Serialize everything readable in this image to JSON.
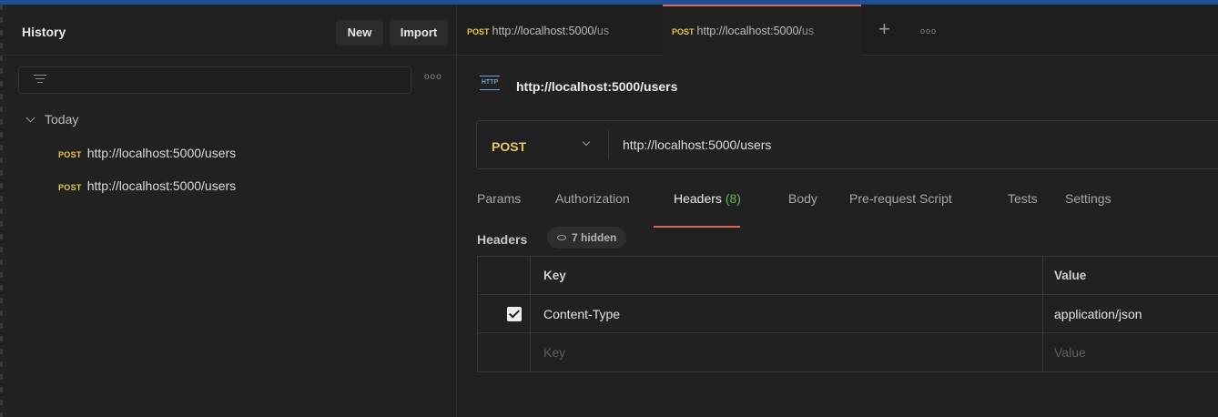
{
  "sidebar": {
    "title": "History",
    "new_label": "New",
    "import_label": "Import",
    "more": "ooo",
    "group_label": "Today",
    "items": [
      {
        "method": "POST",
        "url": "http://localhost:5000/users"
      },
      {
        "method": "POST",
        "url": "http://localhost:5000/users"
      }
    ]
  },
  "tabs": [
    {
      "method": "POST",
      "url_visible": "http://localhost:5000/",
      "url_faded": "us"
    },
    {
      "method": "POST",
      "url_visible": "http://localhost:5000/",
      "url_faded": "us"
    }
  ],
  "tab_plus": "+",
  "tab_more": "ooo",
  "request": {
    "icon_text": "HTTP",
    "title": "http://localhost:5000/users",
    "method": "POST",
    "url": "http://localhost:5000/users"
  },
  "request_tabs": {
    "params": "Params",
    "authorization": "Authorization",
    "headers": "Headers",
    "headers_count": "(8)",
    "body": "Body",
    "prerequest": "Pre-request Script",
    "tests": "Tests",
    "settings": "Settings"
  },
  "headers_section": {
    "label": "Headers",
    "hidden": "7 hidden",
    "col_key": "Key",
    "col_value": "Value",
    "rows": [
      {
        "checked": true,
        "key": "Content-Type",
        "value": "application/json"
      }
    ],
    "placeholder_key": "Key",
    "placeholder_value": "Value"
  },
  "colors": {
    "method_post": "#e6c84a",
    "active_tab": "#d26a5c",
    "count_green": "#5fb85f"
  }
}
